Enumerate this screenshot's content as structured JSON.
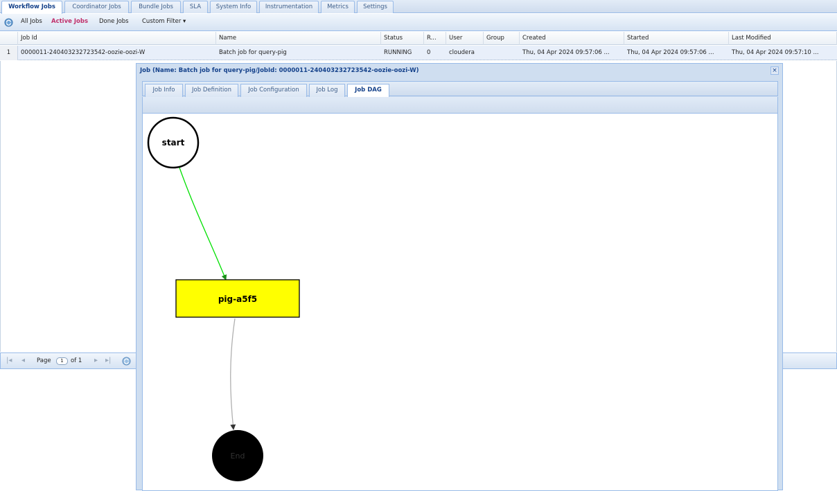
{
  "main_tabs": [
    "Workflow Jobs",
    "Coordinator Jobs",
    "Bundle Jobs",
    "SLA",
    "System Info",
    "Instrumentation",
    "Metrics",
    "Settings"
  ],
  "filters": {
    "all_jobs": "All Jobs",
    "active_jobs": "Active Jobs",
    "done_jobs": "Done Jobs",
    "custom_filter": "Custom Filter ▾"
  },
  "grid": {
    "columns": [
      "Job Id",
      "Name",
      "Status",
      "R...",
      "User",
      "Group",
      "Created",
      "Started",
      "Last Modified"
    ],
    "rows": [
      {
        "num": "1",
        "job_id": "0000011-240403232723542-oozie-oozi-W",
        "name": "Batch job for query-pig",
        "status": "RUNNING",
        "run": "0",
        "user": "cloudera",
        "group": "",
        "created": "Thu, 04 Apr 2024 09:57:06 ...",
        "started": "Thu, 04 Apr 2024 09:57:06 ...",
        "last_modified": "Thu, 04 Apr 2024 09:57:10 ..."
      }
    ]
  },
  "paging": {
    "page_label": "Page",
    "page_value": "1",
    "of_label": "of 1"
  },
  "job_window": {
    "title": "Job (Name: Batch job for query-pig/JobId: 0000011-240403232723542-oozie-oozi-W)",
    "close": "×",
    "tabs": [
      "Job Info",
      "Job Definition",
      "Job Configuration",
      "Job Log",
      "Job DAG"
    ],
    "active_tab": "Job DAG"
  },
  "dag": {
    "nodes": {
      "start": "start",
      "action": "pig-a5f5",
      "end": "End"
    },
    "colors": {
      "action_fill": "#ffff00",
      "success_edge": "#00e000",
      "pending_edge": "#b0b0b0",
      "end_fill": "#000000"
    }
  }
}
